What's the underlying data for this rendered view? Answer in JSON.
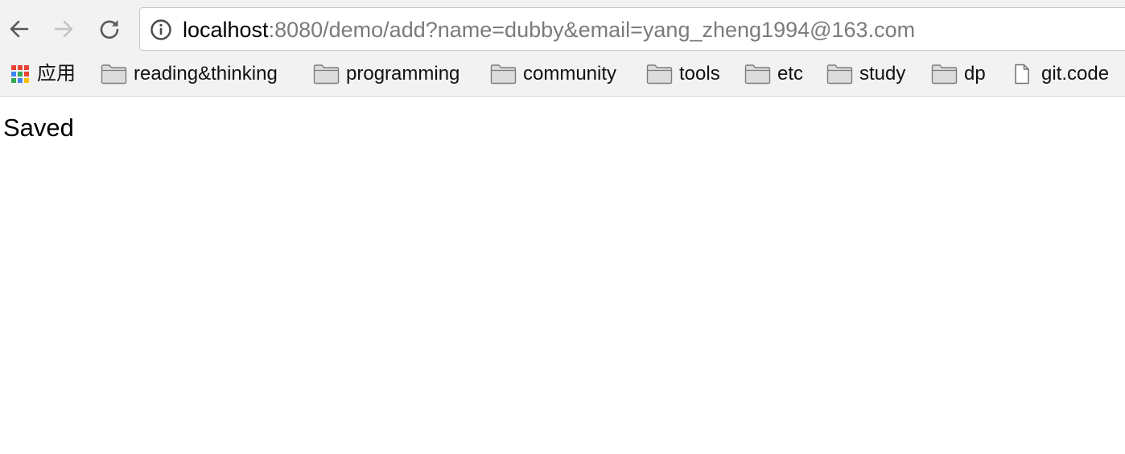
{
  "browser": {
    "url_host": "localhost",
    "url_rest": ":8080/demo/add?name=dubby&email=yang_zheng1994@163.com",
    "nav_icons": [
      "back-arrow-icon",
      "forward-arrow-icon",
      "reload-icon",
      "info-icon"
    ]
  },
  "bookmarks": [
    {
      "label": "应用",
      "icon": "apps-grid-icon"
    },
    {
      "label": "reading&thinking",
      "icon": "folder-icon"
    },
    {
      "label": "programming",
      "icon": "folder-icon"
    },
    {
      "label": "community",
      "icon": "folder-icon"
    },
    {
      "label": "tools",
      "icon": "folder-icon"
    },
    {
      "label": "etc",
      "icon": "folder-icon"
    },
    {
      "label": "study",
      "icon": "folder-icon"
    },
    {
      "label": "dp",
      "icon": "folder-icon"
    },
    {
      "label": "git.code",
      "icon": "page-icon"
    }
  ],
  "page": {
    "message": "Saved"
  },
  "colors": {
    "toolbar_bg": "#f2f2f2",
    "url_host": "#000000",
    "url_rest": "#7b7b7b",
    "apps_red": "#ea4335",
    "apps_yellow": "#fbbc05",
    "apps_green": "#34a853",
    "apps_blue": "#4285f4"
  }
}
